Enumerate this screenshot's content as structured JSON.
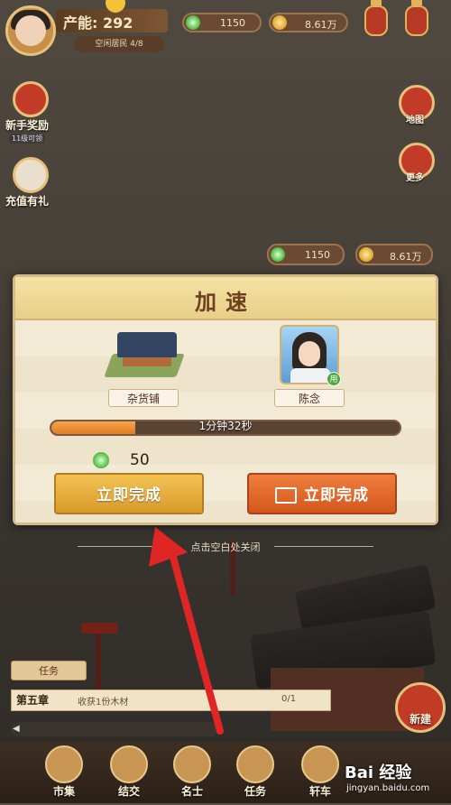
{
  "top_bar": {
    "production_label": "产能: 292",
    "resident_label": "空闲居民 4/8",
    "jade_value": "1150",
    "gold_value": "8.61万"
  },
  "left_menu": {
    "newbie_reward": "新手奖励",
    "newbie_badge": "11级可领",
    "recharge_gift": "充值有礼"
  },
  "right_menu": {
    "map": "地图",
    "more": "更多"
  },
  "overlay_resources": {
    "jade_value": "1150",
    "gold_value": "8.61万"
  },
  "modal": {
    "title": "加速",
    "building_name": "杂货铺",
    "npc_name": "陈念",
    "npc_badge": "用",
    "progress_fraction": 0.24,
    "time_remaining": "1分钟32秒",
    "cost": "50",
    "complete_button": "立即完成",
    "ad_complete_button": "立即完成"
  },
  "close_hint": "点击空白处关闭",
  "quest": {
    "tab_label": "任务",
    "chapter": "第五章",
    "description": "收获1份木材",
    "progress": "0/1"
  },
  "build_button": "新建",
  "bottom_nav": [
    {
      "label": "市集"
    },
    {
      "label": "结交"
    },
    {
      "label": "名士"
    },
    {
      "label": "任务"
    },
    {
      "label": "轩车"
    }
  ],
  "watermark": {
    "brand": "Bai 经验",
    "url": "jingyan.baidu.com"
  },
  "colors": {
    "accent_orange": "#d5571d",
    "accent_gold": "#d99a2b",
    "arrow_red": "#e02525"
  }
}
